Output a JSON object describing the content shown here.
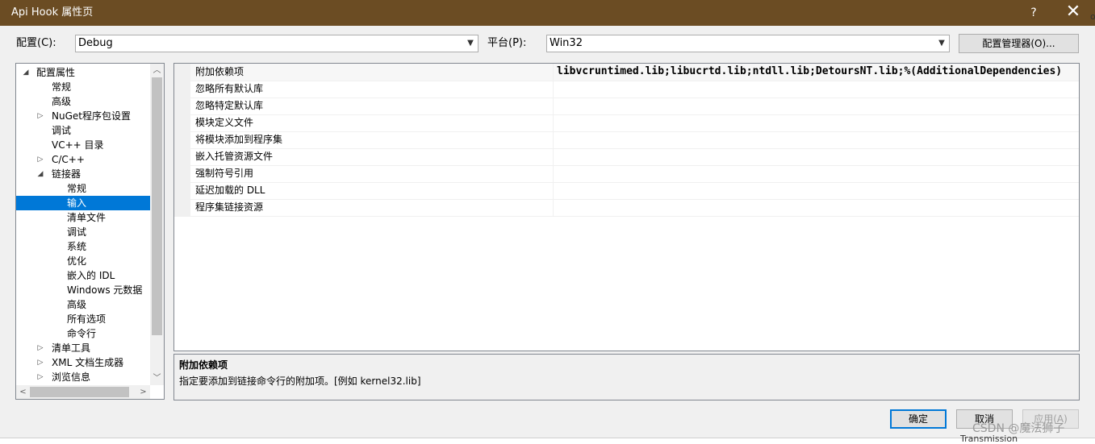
{
  "window": {
    "title": "Api Hook 属性页",
    "help": "?",
    "close": "✕"
  },
  "toolbar": {
    "config_label": "配置(C):",
    "config_value": "Debug",
    "platform_label": "平台(P):",
    "platform_value": "Win32",
    "config_manager_label": "配置管理器(O)..."
  },
  "tree": {
    "items": [
      {
        "label": "配置属性",
        "expander": "◢"
      },
      {
        "label": "常规",
        "expander": ""
      },
      {
        "label": "高级",
        "expander": ""
      },
      {
        "label": "NuGet程序包设置",
        "expander": "▷"
      },
      {
        "label": "调试",
        "expander": ""
      },
      {
        "label": "VC++ 目录",
        "expander": ""
      },
      {
        "label": "C/C++",
        "expander": "▷"
      },
      {
        "label": "链接器",
        "expander": "◢"
      },
      {
        "label": "常规",
        "expander": ""
      },
      {
        "label": "输入",
        "expander": ""
      },
      {
        "label": "清单文件",
        "expander": ""
      },
      {
        "label": "调试",
        "expander": ""
      },
      {
        "label": "系统",
        "expander": ""
      },
      {
        "label": "优化",
        "expander": ""
      },
      {
        "label": "嵌入的 IDL",
        "expander": ""
      },
      {
        "label": "Windows 元数据",
        "expander": ""
      },
      {
        "label": "高级",
        "expander": ""
      },
      {
        "label": "所有选项",
        "expander": ""
      },
      {
        "label": "命令行",
        "expander": ""
      },
      {
        "label": "清单工具",
        "expander": "▷"
      },
      {
        "label": "XML 文档生成器",
        "expander": "▷"
      },
      {
        "label": "浏览信息",
        "expander": "▷"
      }
    ],
    "scroll_up": "︿",
    "scroll_down": "﹀",
    "scroll_left": "<",
    "scroll_right": ">"
  },
  "grid": {
    "rows": [
      {
        "name": "附加依赖项",
        "value": "libvcruntimed.lib;libucrtd.lib;ntdll.lib;DetoursNT.lib;%(AdditionalDependencies)"
      },
      {
        "name": "忽略所有默认库",
        "value": ""
      },
      {
        "name": "忽略特定默认库",
        "value": ""
      },
      {
        "name": "模块定义文件",
        "value": ""
      },
      {
        "name": "将模块添加到程序集",
        "value": ""
      },
      {
        "name": "嵌入托管资源文件",
        "value": ""
      },
      {
        "name": "强制符号引用",
        "value": ""
      },
      {
        "name": "延迟加载的 DLL",
        "value": ""
      },
      {
        "name": "程序集链接资源",
        "value": ""
      }
    ]
  },
  "description": {
    "title": "附加依赖项",
    "text": "指定要添加到链接命令行的附加项。[例如 kernel32.lib]"
  },
  "buttons": {
    "ok": "确定",
    "cancel": "取消",
    "apply": "应用(A)"
  },
  "background": {
    "edge_chars": [
      "o",
      "T",
      "i",
      "A",
      "e",
      "o",
      "p",
      "i"
    ],
    "watermark": "CSDN @魔法狮子",
    "bottom_text": "Transmission"
  },
  "colors": {
    "titlebar": "#6b4c23",
    "selection": "#0078d7"
  }
}
